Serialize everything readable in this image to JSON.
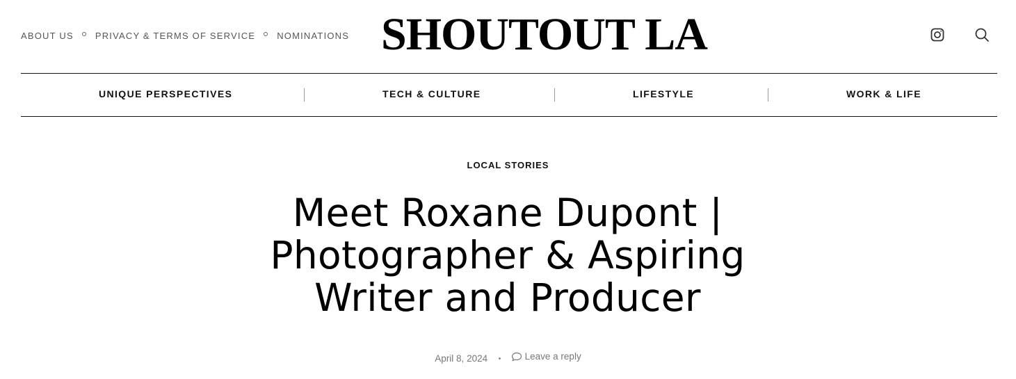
{
  "top_links": [
    "ABOUT US",
    "PRIVACY & TERMS OF SERVICE",
    "NOMINATIONS"
  ],
  "logo": "SHOUTOUT LA",
  "icons": {
    "social": "instagram-icon",
    "search": "search-icon"
  },
  "nav": [
    "UNIQUE PERSPECTIVES",
    "TECH & CULTURE",
    "LIFESTYLE",
    "WORK & LIFE"
  ],
  "article": {
    "category": "LOCAL STORIES",
    "title_lines": [
      "Meet Roxane Dupont |",
      "Photographer & Aspiring",
      "Writer and Producer"
    ],
    "date": "April 8, 2024",
    "comment_link": "Leave a reply"
  },
  "colors": {
    "text": "#111111",
    "muted": "#777777",
    "background": "#ffffff"
  }
}
